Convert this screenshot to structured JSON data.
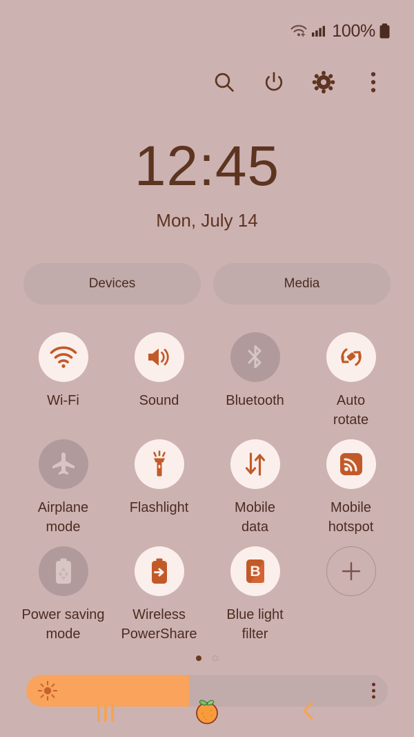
{
  "status_bar": {
    "wifi_icon": "wifi-transfer-icon",
    "signal_icon": "cellular-signal-icon",
    "battery_percent": "100%",
    "battery_icon": "battery-full-icon"
  },
  "action_row": {
    "items": [
      {
        "name": "search-button",
        "icon": "search-icon",
        "label": "Search"
      },
      {
        "name": "power-button",
        "icon": "power-icon",
        "label": "Power off"
      },
      {
        "name": "settings-button",
        "icon": "gear-icon",
        "label": "Settings"
      },
      {
        "name": "more-options-button",
        "icon": "three-dot-menu-icon",
        "label": "More options"
      }
    ]
  },
  "clock": {
    "time": "12:45",
    "date": "Mon, July 14"
  },
  "pills": {
    "devices": "Devices",
    "media": "Media"
  },
  "toggles": [
    {
      "label": "Wi-Fi",
      "icon": "wifi-icon",
      "state": "on"
    },
    {
      "label": "Sound",
      "icon": "volume-icon",
      "state": "on"
    },
    {
      "label": "Bluetooth",
      "icon": "bluetooth-icon",
      "state": "off"
    },
    {
      "label": "Auto\nrotate",
      "icon": "auto-rotate-icon",
      "state": "on"
    },
    {
      "label": "Airplane\nmode",
      "icon": "airplane-icon",
      "state": "off"
    },
    {
      "label": "Flashlight",
      "icon": "flashlight-icon",
      "state": "on"
    },
    {
      "label": "Mobile\ndata",
      "icon": "mobile-data-icon",
      "state": "on"
    },
    {
      "label": "Mobile\nhotspot",
      "icon": "hotspot-icon",
      "state": "on"
    },
    {
      "label": "Power saving\nmode",
      "icon": "battery-saver-icon",
      "state": "off"
    },
    {
      "label": "Wireless\nPowerShare",
      "icon": "powershare-icon",
      "state": "on"
    },
    {
      "label": "Blue light\nfilter",
      "icon": "blue-light-icon",
      "state": "on"
    },
    {
      "label": "",
      "icon": "plus-icon",
      "state": "add"
    }
  ],
  "page_indicator": {
    "total": 2,
    "active": 1
  },
  "brightness": {
    "level_percent": 45,
    "icon": "brightness-sun-icon",
    "menu_icon": "three-dot-menu-icon"
  },
  "nav_bar": {
    "recents": {
      "name": "recents-button",
      "icon": "recents-icon"
    },
    "home": {
      "name": "home-button",
      "icon": "orange-fruit-home-icon"
    },
    "back": {
      "name": "back-button",
      "icon": "chevron-left-icon"
    }
  },
  "colors": {
    "background": "#cdb2b2",
    "accent_orange": "#c15a28",
    "slider_orange": "#f9a35c",
    "text": "#4a2c20",
    "toggle_on_bg": "#fbefec",
    "toggle_off_bg": "#b09a9c",
    "pill_bg": "#c2abab"
  }
}
